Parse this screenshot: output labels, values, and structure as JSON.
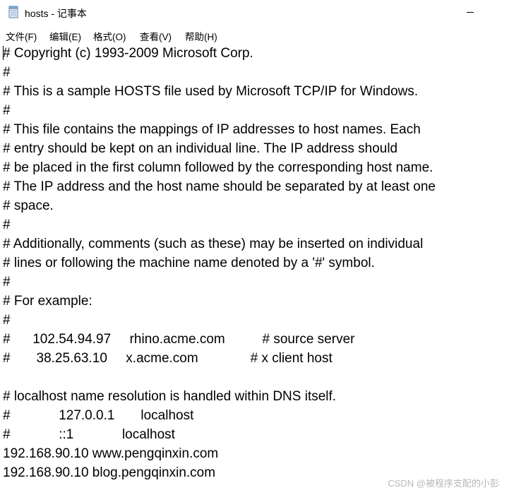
{
  "window": {
    "title": "hosts - 记事本",
    "minimize_icon": "minimize-icon"
  },
  "menu": [
    {
      "label": "文件(F)"
    },
    {
      "label": "编辑(E)"
    },
    {
      "label": "格式(O)"
    },
    {
      "label": "查看(V)"
    },
    {
      "label": "帮助(H)"
    }
  ],
  "document": {
    "lines": [
      "# Copyright (c) 1993-2009 Microsoft Corp.",
      "#",
      "# This is a sample HOSTS file used by Microsoft TCP/IP for Windows.",
      "#",
      "# This file contains the mappings of IP addresses to host names. Each",
      "# entry should be kept on an individual line. The IP address should",
      "# be placed in the first column followed by the corresponding host name.",
      "# The IP address and the host name should be separated by at least one",
      "# space.",
      "#",
      "# Additionally, comments (such as these) may be inserted on individual",
      "# lines or following the machine name denoted by a '#' symbol.",
      "#",
      "# For example:",
      "#",
      "#      102.54.94.97     rhino.acme.com          # source server",
      "#       38.25.63.10     x.acme.com              # x client host",
      "",
      "# localhost name resolution is handled within DNS itself.",
      "#             127.0.0.1       localhost",
      "#             ::1             localhost",
      "192.168.90.10 www.pengqinxin.com",
      "192.168.90.10 blog.pengqinxin.com"
    ]
  },
  "watermark": "CSDN @被程序支配的小彭"
}
